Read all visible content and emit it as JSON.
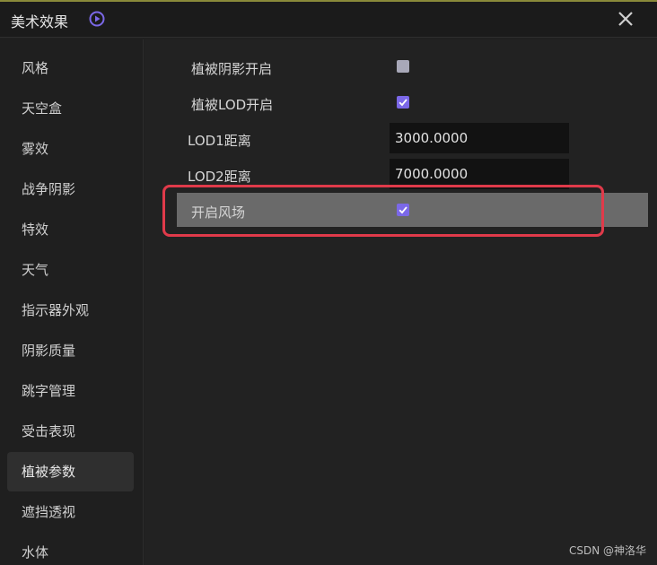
{
  "window": {
    "title": "美术效果",
    "accent_color": "#7b68e8"
  },
  "sidebar": {
    "items": [
      {
        "label": "风格",
        "active": false
      },
      {
        "label": "天空盒",
        "active": false
      },
      {
        "label": "雾效",
        "active": false
      },
      {
        "label": "战争阴影",
        "active": false
      },
      {
        "label": "特效",
        "active": false
      },
      {
        "label": "天气",
        "active": false
      },
      {
        "label": "指示器外观",
        "active": false
      },
      {
        "label": "阴影质量",
        "active": false
      },
      {
        "label": "跳字管理",
        "active": false
      },
      {
        "label": "受击表现",
        "active": false
      },
      {
        "label": "植被参数",
        "active": true
      },
      {
        "label": "遮挡透视",
        "active": false
      },
      {
        "label": "水体",
        "active": false
      }
    ]
  },
  "settings": {
    "veg_shadow": {
      "label": "植被阴影开启",
      "checked": false
    },
    "veg_lod": {
      "label": "植被LOD开启",
      "checked": true
    },
    "lod1": {
      "label": "LOD1距离",
      "value": "3000.0000"
    },
    "lod2": {
      "label": "LOD2距离",
      "value": "7000.0000"
    },
    "wind_field": {
      "label": "开启风场",
      "checked": true
    }
  },
  "annotation": {
    "color": "#e03a4a"
  },
  "watermark": "CSDN @神洛华"
}
